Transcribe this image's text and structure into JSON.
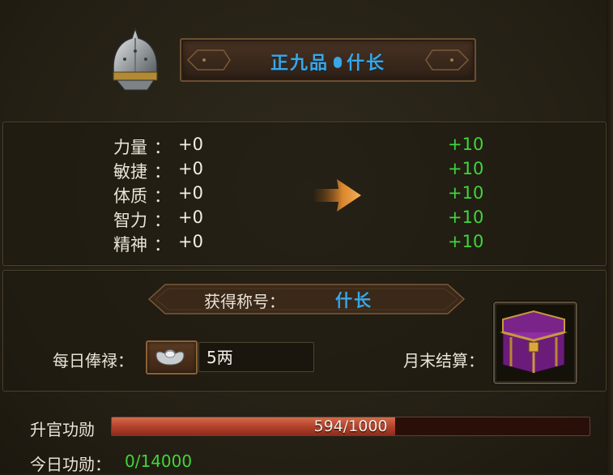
{
  "header": {
    "rank": "正九品",
    "title": "什长"
  },
  "stats": [
    {
      "label": "力量",
      "colon": "：",
      "old": "+0",
      "new": "+10"
    },
    {
      "label": "敏捷",
      "colon": "：",
      "old": "+0",
      "new": "+10"
    },
    {
      "label": "体质",
      "colon": "：",
      "old": "+0",
      "new": "+10"
    },
    {
      "label": "智力",
      "colon": "：",
      "old": "+0",
      "new": "+10"
    },
    {
      "label": "精神",
      "colon": "：",
      "old": "+0",
      "new": "+10"
    }
  ],
  "reward": {
    "name_label": "获得称号：",
    "name_value": "什长",
    "salary_label": "每日俸禄：",
    "salary_value": "5两",
    "month_label": "月末结算："
  },
  "merit": {
    "label": "升官功勋",
    "text": "594/1000",
    "current": 594,
    "max": 1000,
    "today_label": "今日功勋：",
    "today_value": "0/14000"
  },
  "colors": {
    "title_blue": "#38a7e8",
    "bonus_green": "#3fd63b",
    "bar_red": "#b4432d"
  },
  "icons": [
    "helmet-icon",
    "arrow-right-icon",
    "silver-ingot-icon",
    "treasure-chest-icon"
  ]
}
